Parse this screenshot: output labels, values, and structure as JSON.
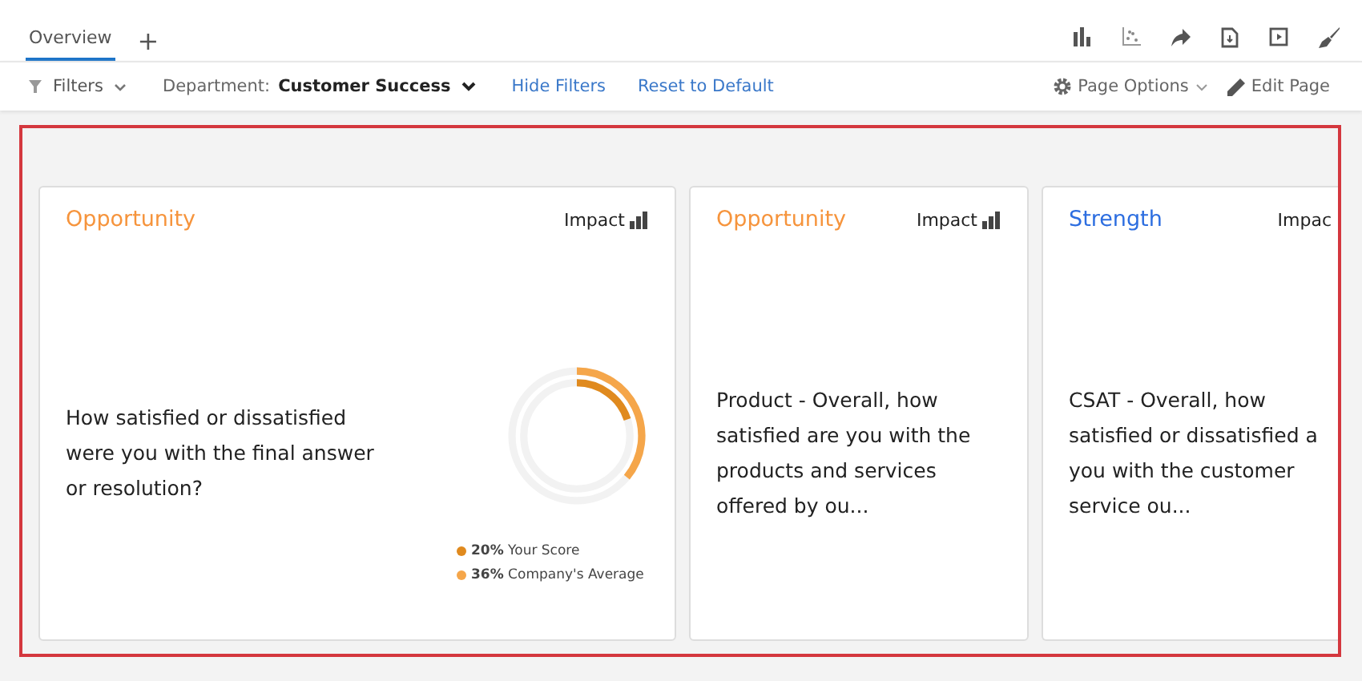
{
  "tabs": [
    {
      "label": "Overview",
      "selected": true
    }
  ],
  "add_tab": "+",
  "filters": {
    "label": "Filters",
    "department_label": "Department:",
    "department_value": "Customer Success",
    "hide": "Hide Filters",
    "reset": "Reset to Default"
  },
  "page_options": "Page Options",
  "edit_page": "Edit Page",
  "cards": [
    {
      "kind": "opportunity",
      "title": "Opportunity",
      "impact": "Impact",
      "lines": [
        "How satisfied or dissatisfied",
        "were you with the final answer",
        "or resolution?"
      ],
      "legend": [
        {
          "text": "**20%** Your Score",
          "color": "#e08a1e"
        },
        {
          "text": "**36%** Company's Average",
          "color": "#f5a64a"
        }
      ]
    },
    {
      "kind": "opportunity",
      "title": "Opportunity",
      "impact": "Impact",
      "lines": [
        "Product - Overall, how",
        "satisfied are you with the",
        "products and services",
        "offered by ou..."
      ]
    },
    {
      "kind": "strength",
      "title": "Strength",
      "impact": "Impac",
      "lines": [
        "CSAT - Overall, how",
        "satisfied or dissatisfied a",
        "you with the customer",
        "service ou..."
      ]
    }
  ]
}
